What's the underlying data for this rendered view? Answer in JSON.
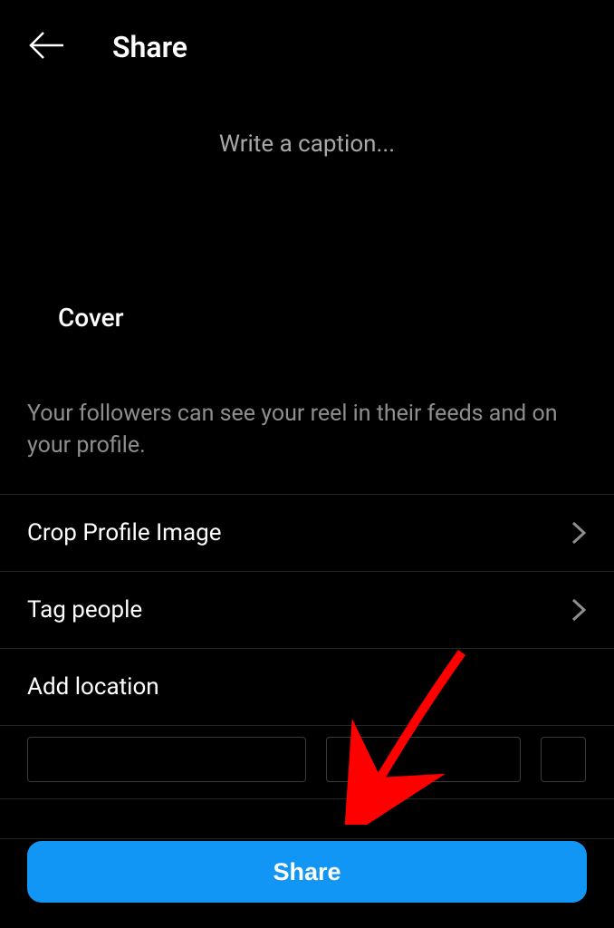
{
  "header": {
    "title": "Share"
  },
  "caption": {
    "placeholder": "Write a caption..."
  },
  "cover": {
    "label": "Cover"
  },
  "info": {
    "text": "Your followers can see your reel in their feeds and on your profile."
  },
  "options": {
    "crop_profile": "Crop Profile Image",
    "tag_people": "Tag people",
    "add_location": "Add location"
  },
  "share_button": {
    "label": "Share"
  }
}
